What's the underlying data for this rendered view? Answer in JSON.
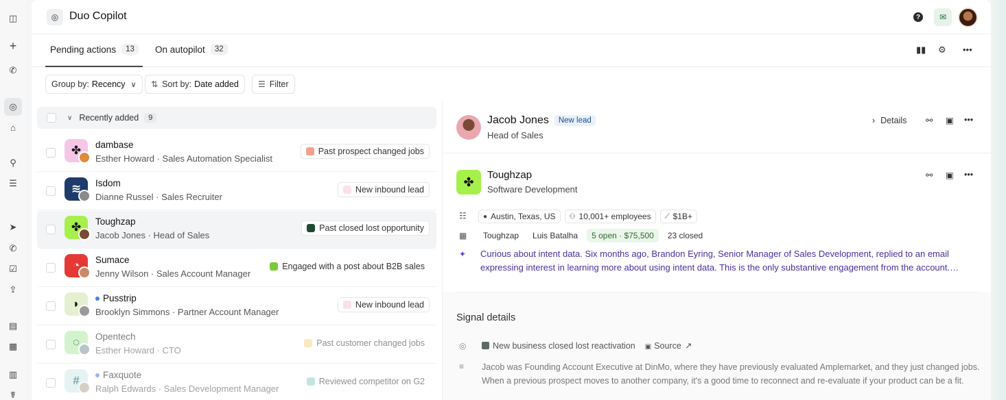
{
  "app": {
    "title": "Duo Copilot"
  },
  "rail": {
    "items": [
      "panel-toggle",
      "plus",
      "phone",
      "copilot",
      "home",
      "search",
      "list",
      "send",
      "phone-2",
      "check",
      "upload",
      "contacts",
      "building",
      "chart",
      "stethoscope"
    ]
  },
  "tabs": [
    {
      "label": "Pending actions",
      "count": "13"
    },
    {
      "label": "On autopilot",
      "count": "32"
    }
  ],
  "toolbar": {
    "group_prefix": "Group by:",
    "group_value": "Recency",
    "sort_prefix": "Sort by:",
    "sort_value": "Date added",
    "filter_label": "Filter"
  },
  "group": {
    "label": "Recently added",
    "count": "9"
  },
  "rows": [
    {
      "company": "dambase",
      "person": "Esther Howard · Sales Automation Specialist",
      "tag": "Past prospect changed jobs",
      "tag_color": "#f2a28c",
      "logo_bg": "#f6c6e8",
      "logo_fg": "#1a1a1a",
      "logo_glyph": "✤",
      "person_color": "#e08a3c"
    },
    {
      "company": "Isdom",
      "person": "Dianne Russel · Sales Recruiter",
      "tag": "New inbound lead",
      "tag_color": "#fbe1ea",
      "logo_bg": "#1e3b6b",
      "logo_fg": "#ffffff",
      "logo_glyph": "≋",
      "person_color": "#8a8a8a"
    },
    {
      "company": "Toughzap",
      "person": "Jacob Jones · Head of Sales",
      "tag": "Past closed lost opportunity",
      "tag_color": "#1f4a33",
      "logo_bg": "#a6f04c",
      "logo_fg": "#111111",
      "logo_glyph": "✤",
      "person_color": "#7a4a36"
    },
    {
      "company": "Sumace",
      "person": "Jenny Wilson · Sales Account Manager",
      "tag": "Engaged with a post about B2B sales",
      "tag_color": "#7acb3a",
      "logo_bg": "#e53935",
      "logo_fg": "#ffffff",
      "logo_glyph": "◔",
      "person_color": "#c98a6a"
    },
    {
      "company": "Pusstrip",
      "person": "Brooklyn Simmons · Partner Account Manager",
      "tag": "New inbound lead",
      "tag_color": "#fbe1ea",
      "logo_bg": "#e4f0d0",
      "logo_fg": "#111111",
      "logo_glyph": "◗",
      "person_color": "#9a9a9a"
    },
    {
      "company": "Opentech",
      "person": "Esther Howard · CTO",
      "tag": "Past customer changed jobs",
      "tag_color": "#f6d88a",
      "logo_bg": "#d3f3cd",
      "logo_fg": "#2f6b3a",
      "logo_glyph": "◌",
      "person_color": "#b9c4cc"
    },
    {
      "company": "Faxquote",
      "person": "Ralph Edwards · Sales Development Manager",
      "tag": "Reviewed competitor on G2",
      "tag_color": "#8fd3c5",
      "logo_bg": "#d6ecec",
      "logo_fg": "#2f6b6b",
      "logo_glyph": "#",
      "person_color": "#c9b8a8"
    }
  ],
  "lead": {
    "name": "Jacob Jones",
    "badge": "New lead",
    "role": "Head of Sales",
    "details_label": "Details"
  },
  "company": {
    "name": "Toughzap",
    "industry": "Software Development",
    "location": "Austin, Texas, US",
    "employees": "10,001+ employees",
    "revenue": "$1B+",
    "crm_name": "Toughzap",
    "owner": "Luis Batalha",
    "open": "5 open · $75,500",
    "closed": "23 closed",
    "summary": "Curious about intent data. Six months ago, Brandon Eyring, Senior Manager of Sales Development, replied to an email expressing interest in learning more about using intent data. This is the only substantive engagement from the account.…"
  },
  "signal": {
    "heading": "Signal details",
    "type": "New business closed lost reactivation",
    "source_label": "Source",
    "description": "Jacob was Founding Account Executive at DinMo, where they have previously evaluated Amplemarket, and they just changed jobs. When a previous prospect moves to another company, it's a good time to reconnect and re-evaluate if your product can be a fit."
  }
}
